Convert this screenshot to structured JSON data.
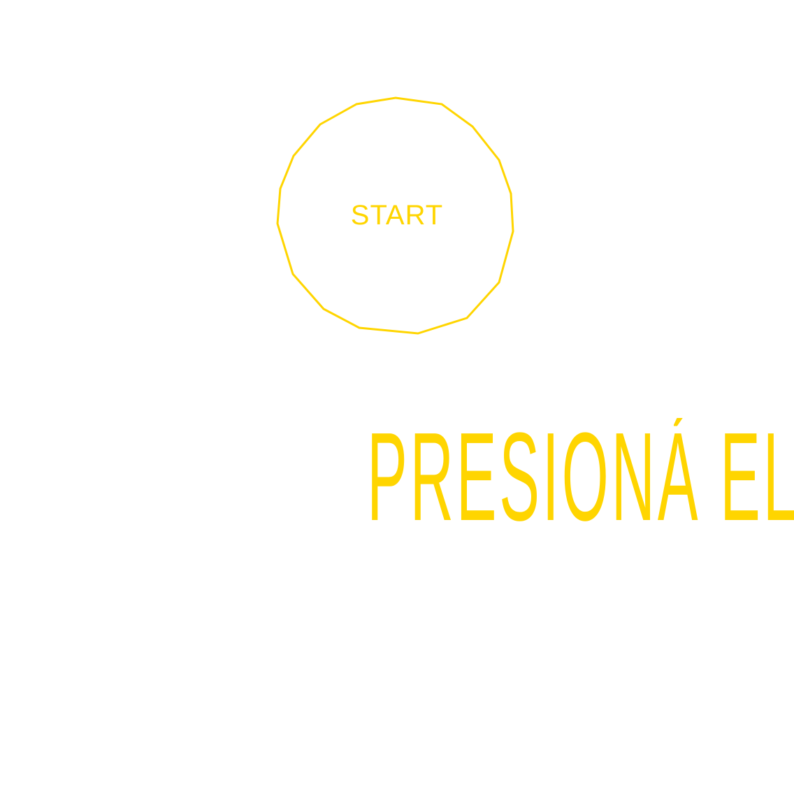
{
  "colors": {
    "accent": "#FFD500",
    "background": "#FFFFFF"
  },
  "start_button": {
    "label": "START",
    "shape": "irregular-polygon-outline"
  },
  "headline": {
    "text": "PRESIONÁ EL BOTÓN"
  }
}
